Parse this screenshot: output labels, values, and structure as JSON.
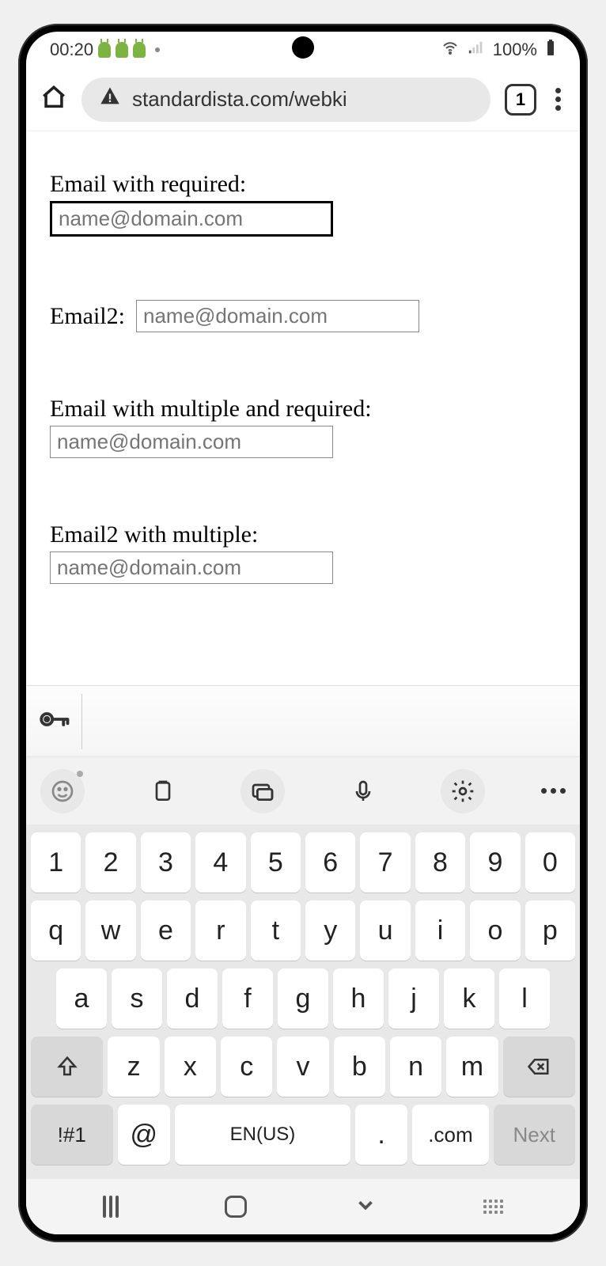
{
  "status": {
    "time": "00:20",
    "battery_pct": "100%"
  },
  "browser": {
    "url": "standardista.com/webki",
    "tab_count": "1"
  },
  "form": {
    "email_required": {
      "label": "Email with required:",
      "placeholder": "name@domain.com"
    },
    "email2": {
      "label": "Email2:",
      "placeholder": "name@domain.com"
    },
    "email_multiple_required": {
      "label": "Email with multiple and required:",
      "placeholder": "name@domain.com"
    },
    "email2_multiple": {
      "label": "Email2 with multiple:",
      "placeholder": "name@domain.com"
    }
  },
  "keyboard": {
    "row1": [
      "1",
      "2",
      "3",
      "4",
      "5",
      "6",
      "7",
      "8",
      "9",
      "0"
    ],
    "row2": [
      "q",
      "w",
      "e",
      "r",
      "t",
      "y",
      "u",
      "i",
      "o",
      "p"
    ],
    "row3": [
      "a",
      "s",
      "d",
      "f",
      "g",
      "h",
      "j",
      "k",
      "l"
    ],
    "row4": [
      "z",
      "x",
      "c",
      "v",
      "b",
      "n",
      "m"
    ],
    "sym": "!#1",
    "at": "@",
    "space": "EN(US)",
    "period": ".",
    "com": ".com",
    "next": "Next"
  }
}
